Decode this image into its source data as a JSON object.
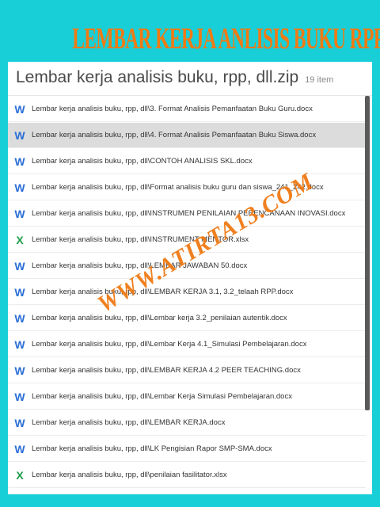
{
  "banner": {
    "text": "LEMBAR KERJA ANLISIS BUKU RPP"
  },
  "header": {
    "title": "Lembar kerja analisis buku, rpp, dll.zip",
    "count": "19 item"
  },
  "watermark": {
    "text": "WWW.ATIRTA13.COM"
  },
  "files": [
    {
      "type": "W",
      "name": "Lembar kerja analisis buku, rpp, dll\\3. Format Analisis Pemanfaatan Buku Guru.docx",
      "selected": false
    },
    {
      "type": "W",
      "name": "Lembar kerja analisis buku, rpp, dll\\4. Format Analisis Pemanfaatan Buku Siswa.docx",
      "selected": true
    },
    {
      "type": "W",
      "name": "Lembar kerja analisis buku, rpp, dll\\CONTOH ANALISIS SKL.docx",
      "selected": false
    },
    {
      "type": "W",
      "name": "Lembar kerja analisis buku, rpp, dll\\Format analisis buku guru dan siswa_241_242.docx",
      "selected": false
    },
    {
      "type": "W",
      "name": "Lembar kerja analisis buku, rpp, dll\\INSTRUMEN PENILAIAN PERENCANAAN INOVASI.docx",
      "selected": false
    },
    {
      "type": "X",
      "name": "Lembar kerja analisis buku, rpp, dll\\INSTRUMENT MENTOR.xlsx",
      "selected": false
    },
    {
      "type": "W",
      "name": "Lembar kerja analisis buku, rpp, dll\\LEMBAR JAWABAN 50.docx",
      "selected": false
    },
    {
      "type": "W",
      "name": "Lembar kerja analisis buku, rpp, dll\\LEMBAR KERJA 3.1, 3.2_telaah RPP.docx",
      "selected": false
    },
    {
      "type": "W",
      "name": "Lembar kerja analisis buku, rpp, dll\\Lembar kerja 3.2_penilaian autentik.docx",
      "selected": false
    },
    {
      "type": "W",
      "name": "Lembar kerja analisis buku, rpp, dll\\Lembar Kerja 4.1_Simulasi Pembelajaran.docx",
      "selected": false
    },
    {
      "type": "W",
      "name": "Lembar kerja analisis buku, rpp, dll\\LEMBAR KERJA 4.2 PEER TEACHING.docx",
      "selected": false
    },
    {
      "type": "W",
      "name": "Lembar kerja analisis buku, rpp, dll\\Lembar Kerja Simulasi Pembelajaran.docx",
      "selected": false
    },
    {
      "type": "W",
      "name": "Lembar kerja analisis buku, rpp, dll\\LEMBAR KERJA.docx",
      "selected": false
    },
    {
      "type": "W",
      "name": "Lembar kerja analisis buku, rpp, dll\\LK Pengisian Rapor SMP-SMA.docx",
      "selected": false
    },
    {
      "type": "X",
      "name": "Lembar kerja analisis buku, rpp, dll\\penilaian fasilitator.xlsx",
      "selected": false
    }
  ]
}
